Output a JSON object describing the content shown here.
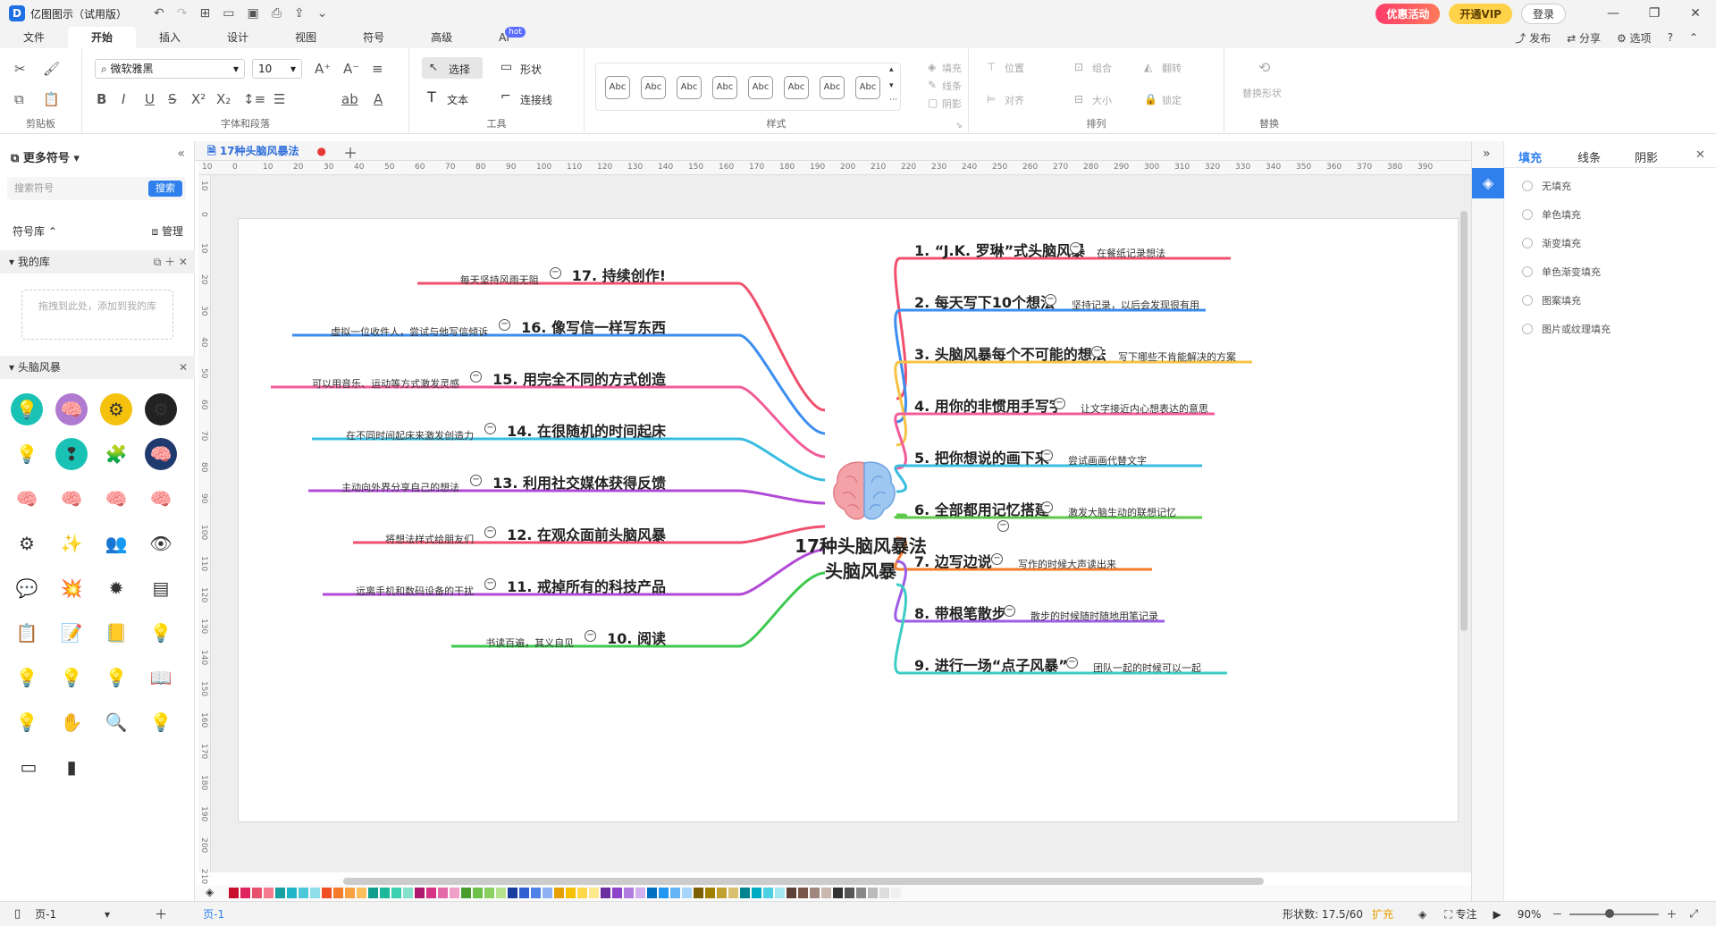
{
  "app": {
    "title": "亿图图示（试用版）",
    "promo": "优惠活动",
    "vip": "开通VIP",
    "login": "登录"
  },
  "menu": {
    "items": [
      "文件",
      "开始",
      "插入",
      "设计",
      "视图",
      "符号",
      "高级",
      "AI"
    ],
    "hot": "hot",
    "publish": "发布",
    "share": "分享",
    "options": "选项"
  },
  "ribbon": {
    "font_name": "微软雅黑",
    "font_size": "10",
    "select": "选择",
    "shape": "形状",
    "text": "文本",
    "connector": "连接线",
    "abc": "Abc",
    "fill": "填充",
    "line": "线条",
    "shadow": "阴影",
    "position": "位置",
    "group": "组合",
    "flip": "翻转",
    "align": "对齐",
    "size": "大小",
    "lock": "锁定",
    "replace_shape": "替换形状",
    "groups": {
      "clipboard": "剪贴板",
      "font": "字体和段落",
      "tools": "工具",
      "styles": "样式",
      "arrange": "排列",
      "replace": "替换"
    }
  },
  "left": {
    "title": "更多符号",
    "search_placeholder": "搜索符号",
    "search_btn": "搜索",
    "lib_label": "符号库",
    "manage": "管理",
    "my_lib": "我的库",
    "drop_hint": "拖拽到此处，添加到我的库",
    "category": "头脑风暴"
  },
  "tabs": {
    "doc": "17种头脑风暴法"
  },
  "ruler": {
    "h": [
      "10",
      "0",
      "10",
      "20",
      "30",
      "40",
      "50",
      "60",
      "70",
      "80",
      "90",
      "100",
      "110",
      "120",
      "130",
      "140",
      "150",
      "160",
      "170",
      "180",
      "190",
      "200",
      "210",
      "220",
      "230",
      "240",
      "250",
      "260",
      "270",
      "280",
      "290",
      "300",
      "310",
      "320",
      "330",
      "340",
      "350",
      "360",
      "370",
      "380",
      "390"
    ],
    "v": [
      "10",
      "0",
      "10",
      "20",
      "30",
      "40",
      "50",
      "60",
      "70",
      "80",
      "90",
      "100",
      "110",
      "120",
      "130",
      "140",
      "150",
      "160",
      "170",
      "180",
      "190",
      "200",
      "210"
    ]
  },
  "mindmap": {
    "center": [
      "17种头脑风暴法",
      "头脑风暴"
    ],
    "right": [
      {
        "title": "1. “J.K. 罗琳”式头脑风暴",
        "desc": "在餐纸记录想法",
        "color": "#f0506e"
      },
      {
        "title": "2. 每天写下10个想法",
        "desc": "坚持记录，以后会发现很有用",
        "color": "#3b8ef0"
      },
      {
        "title": "3. 头脑风暴每个不可能的想法",
        "desc": "写下哪些不肯能解决的方案",
        "color": "#f6c344"
      },
      {
        "title": "4. 用你的非惯用手写字",
        "desc": "让文字接近内心想表达的意思",
        "color": "#f25c9a"
      },
      {
        "title": "5. 把你想说的画下来",
        "desc": "尝试画画代替文字",
        "color": "#38bde0"
      },
      {
        "title": "6. 全部都用记忆搭建",
        "desc": "激发大脑生动的联想记忆",
        "color": "#5cc94a"
      },
      {
        "title": "7. 边写边说",
        "desc": "写作的时候大声读出来",
        "color": "#f57c2b"
      },
      {
        "title": "8. 带根笔散步",
        "desc": "散步的时候随时随地用笔记录",
        "color": "#9b5de5"
      },
      {
        "title": "9. 进行一场“点子风暴”",
        "desc": "团队一起的时候可以一起",
        "color": "#3ccdc5"
      }
    ],
    "left": [
      {
        "title": "17. 持续创作!",
        "desc": "每天坚持风雨无阻",
        "color": "#f0506e"
      },
      {
        "title": "16. 像写信一样写东西",
        "desc": "虚拟一位收件人，尝试与他写信倾诉",
        "color": "#3b8ef0"
      },
      {
        "title": "15. 用完全不同的方式创造",
        "desc": "可以用音乐、运动等方式激发灵感",
        "color": "#f25c9a"
      },
      {
        "title": "14. 在很随机的时间起床",
        "desc": "在不同时间起床来激发创造力",
        "color": "#38bde0"
      },
      {
        "title": "13. 利用社交媒体获得反馈",
        "desc": "主动向外界分享自己的想法",
        "color": "#b04ad6"
      },
      {
        "title": "12. 在观众面前头脑风暴",
        "desc": "将想法样式给朋友们",
        "color": "#f0506e"
      },
      {
        "title": "11. 戒掉所有的科技产品",
        "desc": "远离手机和数码设备的干扰",
        "color": "#b04ad6"
      },
      {
        "title": "10. 阅读",
        "desc": "书读百遍，其义自见",
        "color": "#3ec94f"
      }
    ]
  },
  "status": {
    "page_sel": "页-1",
    "page_tab": "页-1",
    "shape_count": "形状数: 17.5/60",
    "expand": "扩充",
    "focus": "专注",
    "zoom": "90%"
  },
  "right": {
    "tabs": [
      "填充",
      "线条",
      "阴影"
    ],
    "options": [
      "无填充",
      "单色填充",
      "渐变填充",
      "单色渐变填充",
      "图案填充",
      "图片或纹理填充"
    ]
  },
  "palette": [
    "#c8102e",
    "#e0245e",
    "#e8516d",
    "#f47a8e",
    "#16a0a0",
    "#1fb5c8",
    "#4cc9d8",
    "#8fdde8",
    "#f04e23",
    "#f57c2b",
    "#f9a03f",
    "#fbbf60",
    "#0f9d8e",
    "#1cb89a",
    "#3ccfb0",
    "#85e0cc",
    "#b0186e",
    "#d63384",
    "#e26aa6",
    "#f0a0c8",
    "#4a9b2e",
    "#6cc04a",
    "#8ad05e",
    "#b4e28c",
    "#1a3c9e",
    "#2f5fd1",
    "#4f82e8",
    "#8fb0f2",
    "#e6a100",
    "#f4c000",
    "#ffd84a",
    "#ffe88c",
    "#6b2fa0",
    "#8e44c9",
    "#b07ce0",
    "#d2b0f0",
    "#0070c0",
    "#2196f3",
    "#64b5f6",
    "#a6d4fa",
    "#7b5e00",
    "#a08000",
    "#c0a030",
    "#d8c070",
    "#00838f",
    "#00acc1",
    "#4dd0e1",
    "#a3e8f0",
    "#5d4037",
    "#795548",
    "#a1887f",
    "#c8b8b0",
    "#333333",
    "#555555",
    "#888888",
    "#bbbbbb",
    "#dddddd",
    "#f0f0f0"
  ]
}
